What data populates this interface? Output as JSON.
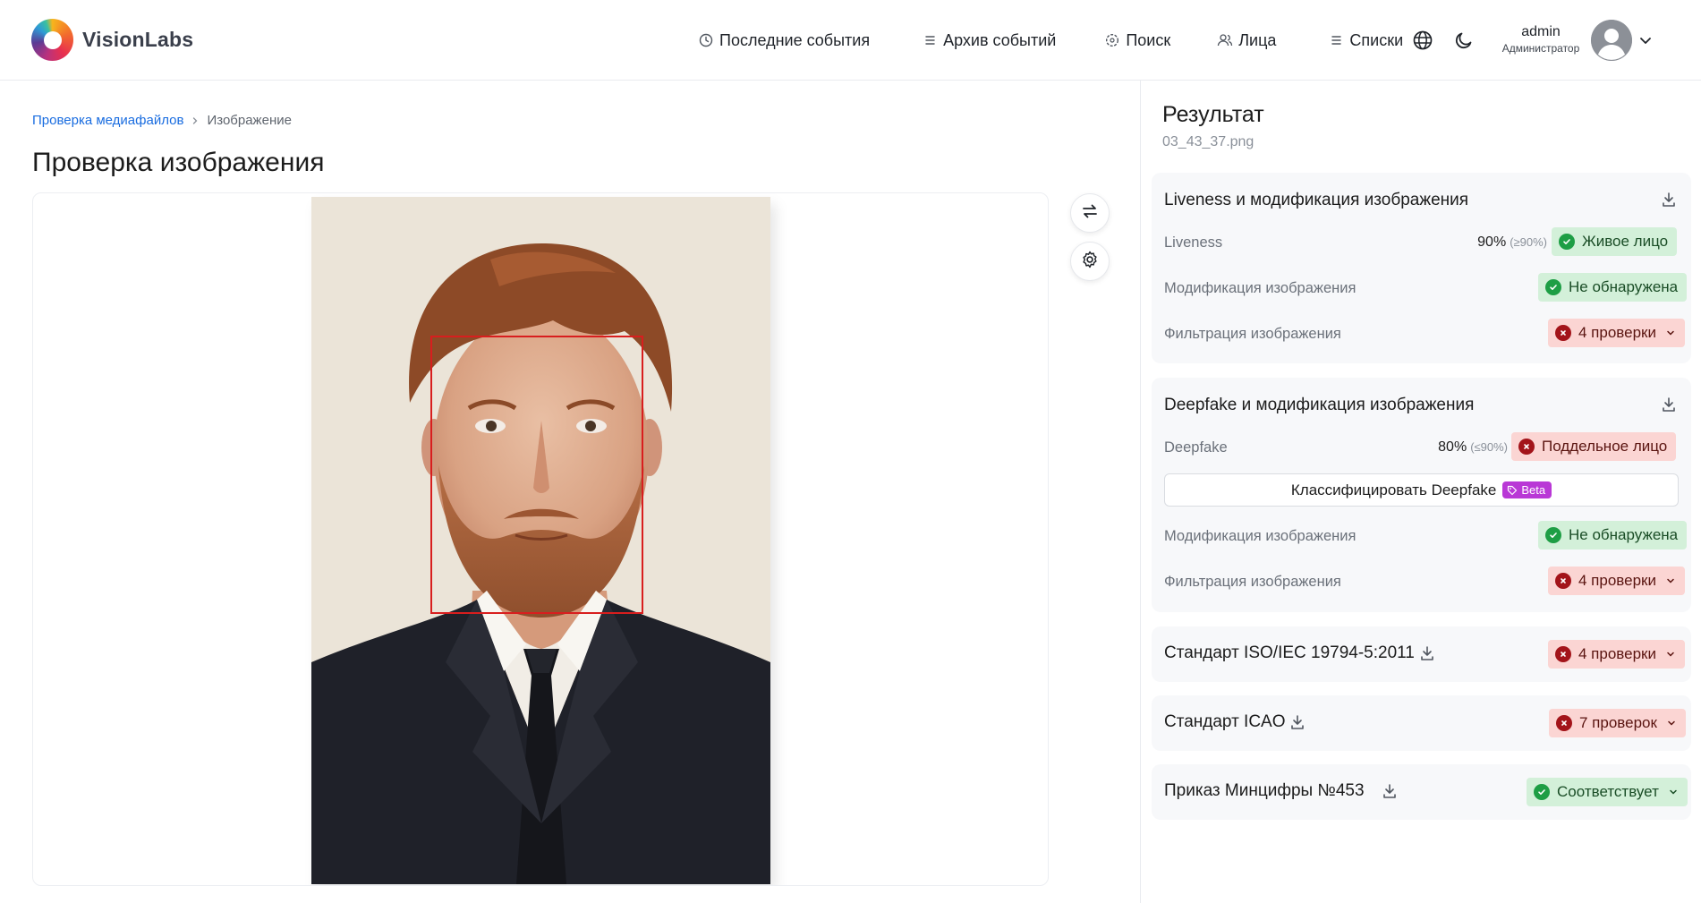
{
  "header": {
    "logo_text": "VisionLabs",
    "nav": [
      {
        "label": "Последние события",
        "icon": "clock-icon"
      },
      {
        "label": "Архив событий",
        "icon": "list-icon"
      },
      {
        "label": "Поиск",
        "icon": "search-circle-icon"
      },
      {
        "label": "Лица",
        "icon": "users-icon"
      },
      {
        "label": "Списки",
        "icon": "list-icon"
      }
    ],
    "user": {
      "name": "admin",
      "role": "Администратор"
    }
  },
  "breadcrumb": {
    "parent": "Проверка медиафайлов",
    "current": "Изображение"
  },
  "page_title": "Проверка изображения",
  "result": {
    "title": "Результат",
    "filename": "03_43_37.png",
    "liveness_card": {
      "title": "Liveness и модификация изображения",
      "liveness_label": "Liveness",
      "liveness_value": "90%",
      "liveness_threshold": "(≥90%)",
      "liveness_badge": "Живое лицо",
      "modification_label": "Модификация изображения",
      "modification_badge": "Не обнаружена",
      "filtration_label": "Фильтрация изображения",
      "filtration_badge": "4 проверки"
    },
    "deepfake_card": {
      "title": "Deepfake и модификация изображения",
      "deepfake_label": "Deepfake",
      "deepfake_value": "80%",
      "deepfake_threshold": "(≤90%)",
      "deepfake_badge": "Поддельное лицо",
      "classify_label": "Классифицировать Deepfake",
      "beta_label": "Beta",
      "modification_label": "Модификация изображения",
      "modification_badge": "Не обнаружена",
      "filtration_label": "Фильтрация изображения",
      "filtration_badge": "4 проверки"
    },
    "iso_card": {
      "title": "Стандарт ISO/IEC 19794-5:2011",
      "badge": "4 проверки"
    },
    "icao_card": {
      "title": "Стандарт ICAO",
      "badge": "7 проверок"
    },
    "mincifry_card": {
      "title": "Приказ Минцифры №453",
      "badge": "Соответствует"
    }
  },
  "colors": {
    "accent_link": "#1a6de0",
    "ok_bg": "#d3f0d9",
    "ok_icon": "#1e9e45",
    "bad_bg": "#fbd5d3",
    "bad_icon": "#a3141a",
    "beta": "#b938d6",
    "face_box": "#d81e1e"
  }
}
